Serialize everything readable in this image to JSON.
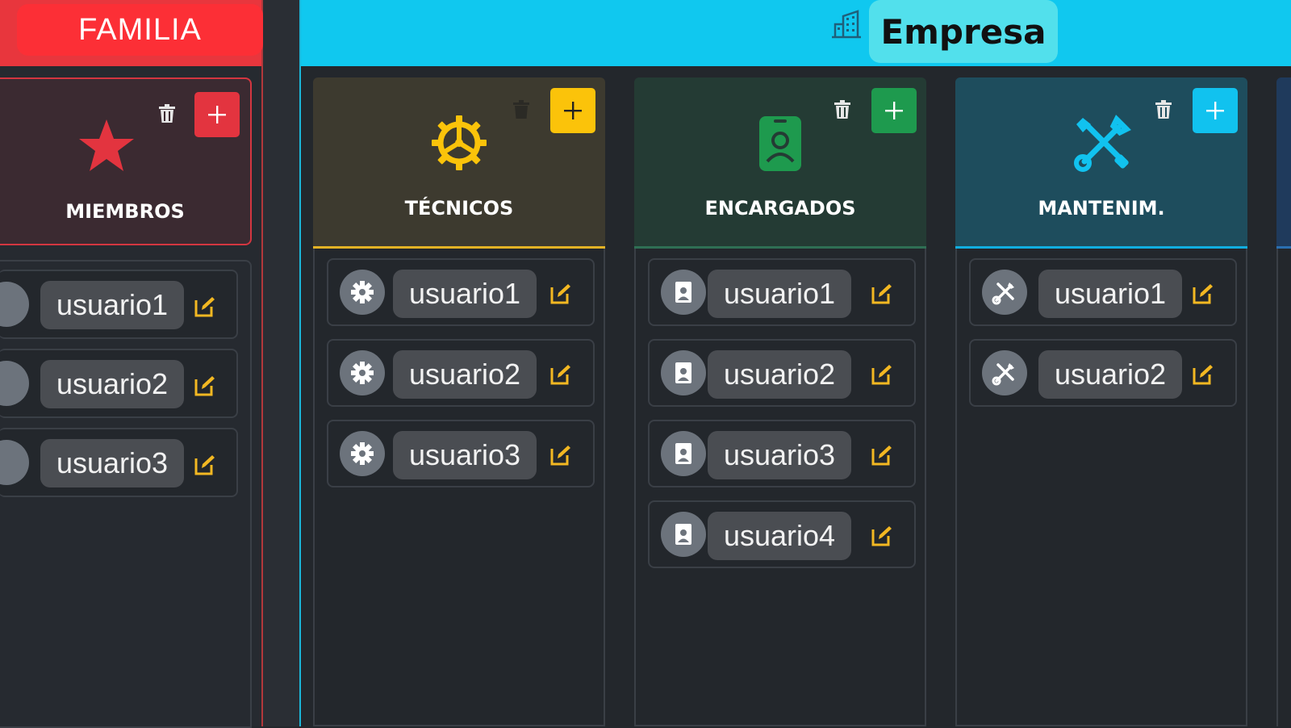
{
  "familia": {
    "title": "FAMILIA",
    "column": {
      "title": "MIEMBROS",
      "accent": "#e3343f",
      "users": [
        "usuario1",
        "usuario2",
        "usuario3"
      ]
    }
  },
  "empresa": {
    "title": "Empresa",
    "columns": [
      {
        "title": "TÉCNICOS",
        "accent": "#fbc30a",
        "users": [
          "usuario1",
          "usuario2",
          "usuario3"
        ]
      },
      {
        "title": "ENCARGADOS",
        "accent": "#1e9a4e",
        "users": [
          "usuario1",
          "usuario2",
          "usuario3",
          "usuario4"
        ]
      },
      {
        "title": "MANTENIM.",
        "accent": "#11c2ef",
        "users": [
          "usuario1",
          "usuario2"
        ]
      }
    ]
  },
  "colors": {
    "background": "#23272c",
    "familia_header": "#e8363d",
    "empresa_header": "#10c8ef",
    "edit_icon": "#f3b822",
    "name_pill": "#4a4d52"
  },
  "icons": {
    "header": "building-icon",
    "delete": "trash-icon",
    "add": "plus-icon",
    "edit": "edit-icon",
    "miembros": "star-icon",
    "tecnicos": "gear-icon",
    "encargados": "id-badge-icon",
    "mantenim": "tools-icon"
  }
}
